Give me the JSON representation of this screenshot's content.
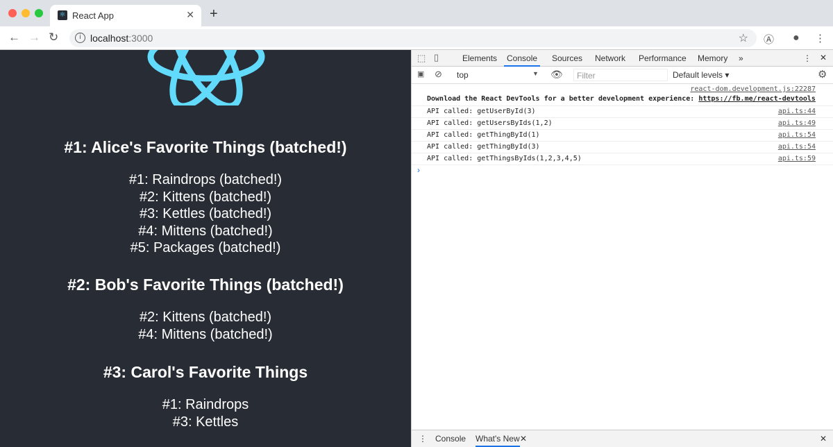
{
  "browser": {
    "tab_title": "React App",
    "url_host": "localhost",
    "url_port": ":3000"
  },
  "page": {
    "sections": [
      {
        "heading": "#1: Alice's Favorite Things (batched!)",
        "items": [
          "#1: Raindrops (batched!)",
          "#2: Kittens (batched!)",
          "#3: Kettles (batched!)",
          "#4: Mittens (batched!)",
          "#5: Packages (batched!)"
        ]
      },
      {
        "heading": "#2: Bob's Favorite Things (batched!)",
        "items": [
          "#2: Kittens (batched!)",
          "#4: Mittens (batched!)"
        ]
      },
      {
        "heading": "#3: Carol's Favorite Things",
        "items": [
          "#1: Raindrops",
          "#3: Kettles"
        ]
      }
    ]
  },
  "devtools": {
    "tabs": [
      "Elements",
      "Console",
      "Sources",
      "Network",
      "Performance",
      "Memory"
    ],
    "more": "»",
    "context": "top",
    "filter_placeholder": "Filter",
    "levels": "Default levels ▾",
    "first_log": {
      "source": "react-dom.development.js:22287",
      "message": "Download the React DevTools for a better development experience: ",
      "link": "https://fb.me/react-devtools"
    },
    "logs": [
      {
        "message": "API called: getUserById(3)",
        "source": "api.ts:44"
      },
      {
        "message": "API called: getUsersByIds(1,2)",
        "source": "api.ts:49"
      },
      {
        "message": "API called: getThingById(1)",
        "source": "api.ts:54"
      },
      {
        "message": "API called: getThingById(3)",
        "source": "api.ts:54"
      },
      {
        "message": "API called: getThingsByIds(1,2,3,4,5)",
        "source": "api.ts:59"
      }
    ],
    "prompt": "›",
    "drawer_tabs": [
      "Console",
      "What's New"
    ]
  },
  "colors": {
    "page_bg": "#282c34",
    "react_blue": "#61dafb",
    "devtools_accent": "#1a73e8"
  }
}
